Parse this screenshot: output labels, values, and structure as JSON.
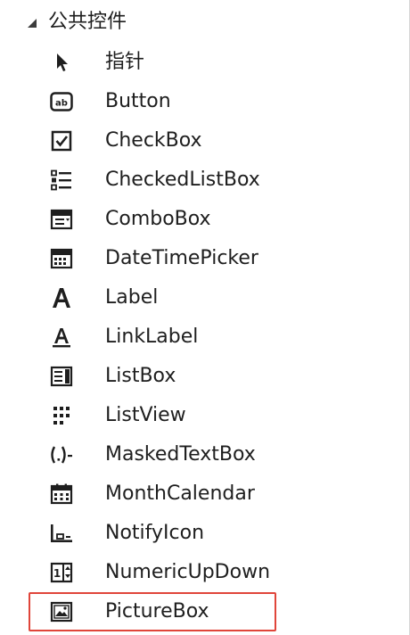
{
  "toolbox": {
    "group_title": "公共控件",
    "items": [
      {
        "label": "指针",
        "icon": "pointer-icon"
      },
      {
        "label": "Button",
        "icon": "button-icon"
      },
      {
        "label": "CheckBox",
        "icon": "checkbox-icon"
      },
      {
        "label": "CheckedListBox",
        "icon": "checked-list-box-icon"
      },
      {
        "label": "ComboBox",
        "icon": "combo-box-icon"
      },
      {
        "label": "DateTimePicker",
        "icon": "date-time-picker-icon"
      },
      {
        "label": "Label",
        "icon": "label-icon"
      },
      {
        "label": "LinkLabel",
        "icon": "link-label-icon"
      },
      {
        "label": "ListBox",
        "icon": "list-box-icon"
      },
      {
        "label": "ListView",
        "icon": "list-view-icon"
      },
      {
        "label": "MaskedTextBox",
        "icon": "masked-text-box-icon"
      },
      {
        "label": "MonthCalendar",
        "icon": "month-calendar-icon"
      },
      {
        "label": "NotifyIcon",
        "icon": "notify-icon-icon"
      },
      {
        "label": "NumericUpDown",
        "icon": "numeric-up-down-icon"
      },
      {
        "label": "PictureBox",
        "icon": "picture-box-icon"
      }
    ],
    "colors": {
      "highlight_border": "#e0453a",
      "icon": "#1e1e1e"
    }
  }
}
